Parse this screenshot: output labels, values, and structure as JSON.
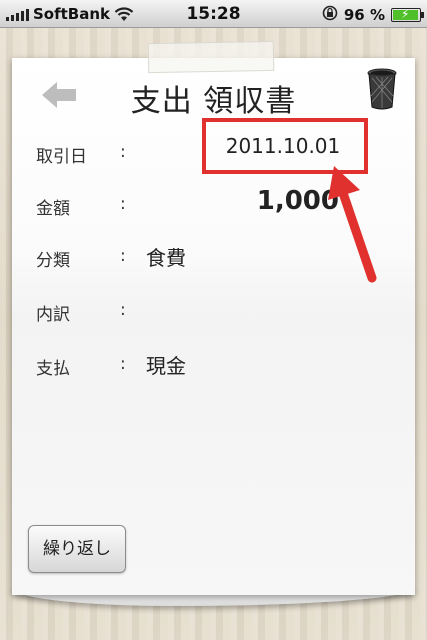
{
  "status_bar": {
    "carrier": "SoftBank",
    "time": "15:28",
    "battery_percent": "96 %",
    "battery_level": 0.96
  },
  "header": {
    "title": "支出 領収書",
    "back_icon": "back-arrow-icon",
    "trash_icon": "trash-can-icon"
  },
  "fields": {
    "date": {
      "label": "取引日",
      "colon": ":",
      "value": "2011.10.01"
    },
    "amount": {
      "label": "金額",
      "colon": ":",
      "value": "1,000"
    },
    "category": {
      "label": "分類",
      "colon": ":",
      "value": "食費"
    },
    "detail": {
      "label": "内訳",
      "colon": ":",
      "value": ""
    },
    "payment": {
      "label": "支払",
      "colon": ":",
      "value": "現金"
    }
  },
  "actions": {
    "repeat_label": "繰り返し"
  },
  "colors": {
    "annotation": "#e0312f",
    "battery": "#4fc02a"
  }
}
